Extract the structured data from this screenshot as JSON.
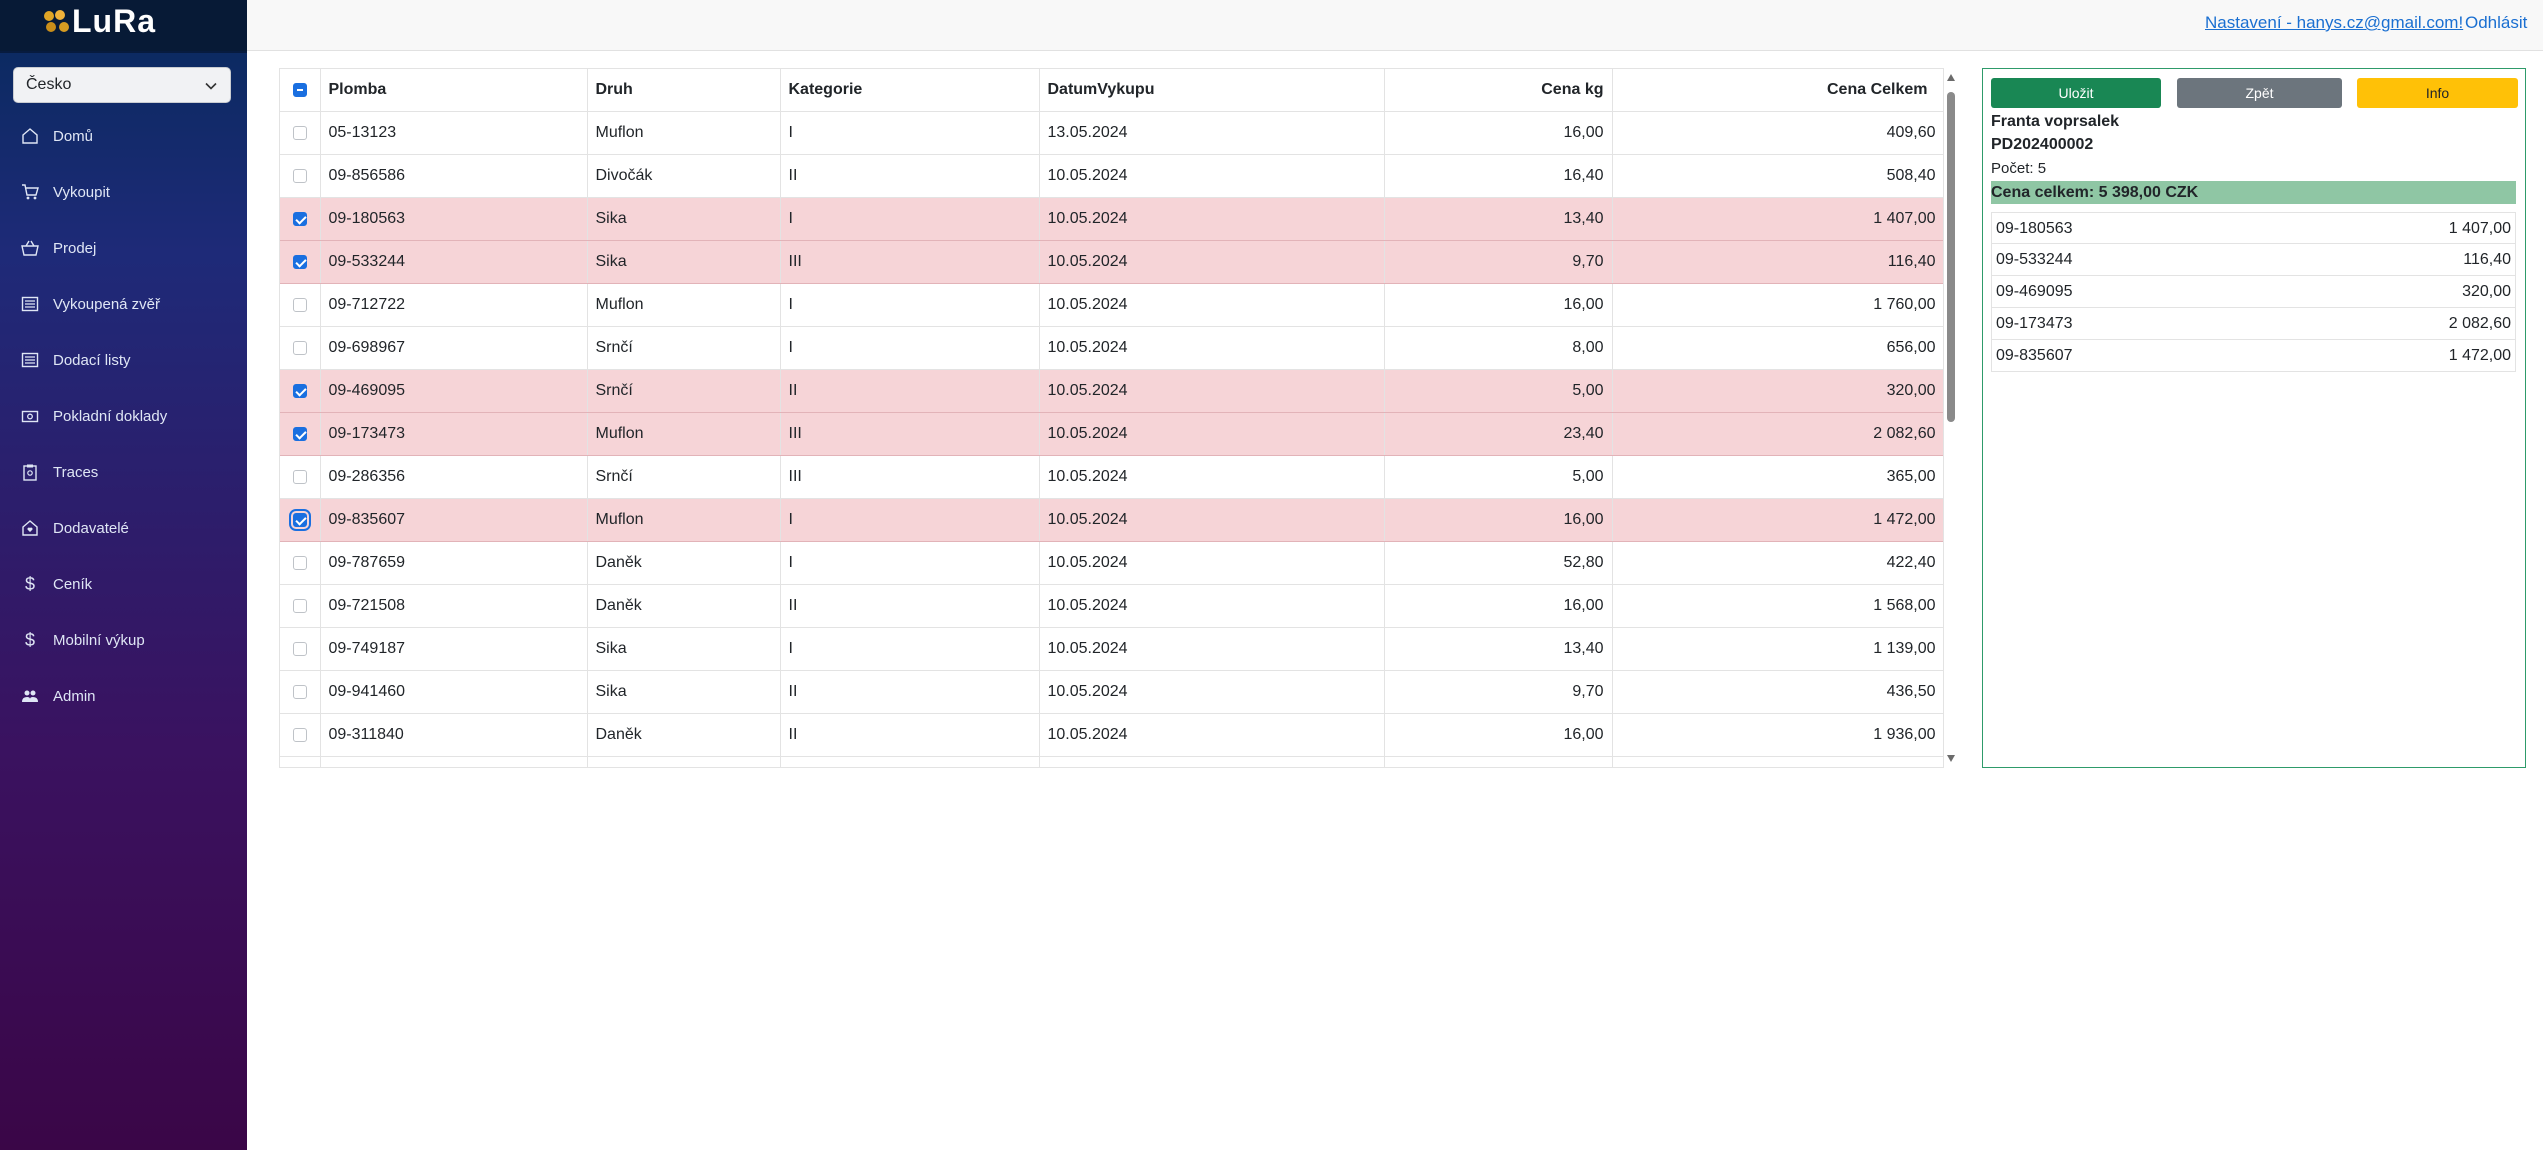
{
  "app": {
    "brand": "LuRa"
  },
  "sidebar": {
    "country": "Česko",
    "items": [
      {
        "label": "Domů",
        "icon": "home-icon"
      },
      {
        "label": "Vykoupit",
        "icon": "cart-icon"
      },
      {
        "label": "Prodej",
        "icon": "basket-icon"
      },
      {
        "label": "Vykoupená zvěř",
        "icon": "list-icon"
      },
      {
        "label": "Dodací listy",
        "icon": "list-icon"
      },
      {
        "label": "Pokladní doklady",
        "icon": "cash-icon"
      },
      {
        "label": "Traces",
        "icon": "clipboard-icon"
      },
      {
        "label": "Dodavatelé",
        "icon": "house-heart-icon"
      },
      {
        "label": "Ceník",
        "icon": "dollar-icon"
      },
      {
        "label": "Mobilní výkup",
        "icon": "dollar-icon"
      },
      {
        "label": "Admin",
        "icon": "people-icon"
      }
    ]
  },
  "topbar": {
    "settings_link": "Nastavení - hanys.cz@gmail.com!",
    "logout_link": "Odhlásit"
  },
  "table": {
    "columns": [
      "Plomba",
      "Druh",
      "Kategorie",
      "DatumVykupu",
      "Cena kg",
      "Cena Celkem"
    ],
    "rows": [
      {
        "checked": false,
        "plomba": "05-13123",
        "druh": "Muflon",
        "kategorie": "I",
        "datum": "13.05.2024",
        "cena_kg": "16,00",
        "cena_celkem": "409,60"
      },
      {
        "checked": false,
        "plomba": "09-856586",
        "druh": "Divočák",
        "kategorie": "II",
        "datum": "10.05.2024",
        "cena_kg": "16,40",
        "cena_celkem": "508,40"
      },
      {
        "checked": true,
        "plomba": "09-180563",
        "druh": "Sika",
        "kategorie": "I",
        "datum": "10.05.2024",
        "cena_kg": "13,40",
        "cena_celkem": "1 407,00"
      },
      {
        "checked": true,
        "plomba": "09-533244",
        "druh": "Sika",
        "kategorie": "III",
        "datum": "10.05.2024",
        "cena_kg": "9,70",
        "cena_celkem": "116,40"
      },
      {
        "checked": false,
        "plomba": "09-712722",
        "druh": "Muflon",
        "kategorie": "I",
        "datum": "10.05.2024",
        "cena_kg": "16,00",
        "cena_celkem": "1 760,00"
      },
      {
        "checked": false,
        "plomba": "09-698967",
        "druh": "Srnčí",
        "kategorie": "I",
        "datum": "10.05.2024",
        "cena_kg": "8,00",
        "cena_celkem": "656,00"
      },
      {
        "checked": true,
        "plomba": "09-469095",
        "druh": "Srnčí",
        "kategorie": "II",
        "datum": "10.05.2024",
        "cena_kg": "5,00",
        "cena_celkem": "320,00"
      },
      {
        "checked": true,
        "plomba": "09-173473",
        "druh": "Muflon",
        "kategorie": "III",
        "datum": "10.05.2024",
        "cena_kg": "23,40",
        "cena_celkem": "2 082,60"
      },
      {
        "checked": false,
        "plomba": "09-286356",
        "druh": "Srnčí",
        "kategorie": "III",
        "datum": "10.05.2024",
        "cena_kg": "5,00",
        "cena_celkem": "365,00"
      },
      {
        "checked": true,
        "focused": true,
        "plomba": "09-835607",
        "druh": "Muflon",
        "kategorie": "I",
        "datum": "10.05.2024",
        "cena_kg": "16,00",
        "cena_celkem": "1 472,00"
      },
      {
        "checked": false,
        "plomba": "09-787659",
        "druh": "Daněk",
        "kategorie": "I",
        "datum": "10.05.2024",
        "cena_kg": "52,80",
        "cena_celkem": "422,40"
      },
      {
        "checked": false,
        "plomba": "09-721508",
        "druh": "Daněk",
        "kategorie": "II",
        "datum": "10.05.2024",
        "cena_kg": "16,00",
        "cena_celkem": "1 568,00"
      },
      {
        "checked": false,
        "plomba": "09-749187",
        "druh": "Sika",
        "kategorie": "I",
        "datum": "10.05.2024",
        "cena_kg": "13,40",
        "cena_celkem": "1 139,00"
      },
      {
        "checked": false,
        "plomba": "09-941460",
        "druh": "Sika",
        "kategorie": "II",
        "datum": "10.05.2024",
        "cena_kg": "9,70",
        "cena_celkem": "436,50"
      },
      {
        "checked": false,
        "plomba": "09-311840",
        "druh": "Daněk",
        "kategorie": "II",
        "datum": "10.05.2024",
        "cena_kg": "16,00",
        "cena_celkem": "1 936,00"
      }
    ]
  },
  "panel": {
    "buttons": {
      "save": "Uložit",
      "back": "Zpět",
      "info": "Info"
    },
    "supplier_name": "Franta voprsalek",
    "document_code": "PD202400002",
    "count_text": "Počet: 5",
    "total_text": "Cena celkem: 5 398,00 CZK",
    "items": [
      {
        "plomba": "09-180563",
        "cena": "1 407,00"
      },
      {
        "plomba": "09-533244",
        "cena": "116,40"
      },
      {
        "plomba": "09-469095",
        "cena": "320,00"
      },
      {
        "plomba": "09-173473",
        "cena": "2 082,60"
      },
      {
        "plomba": "09-835607",
        "cena": "1 472,00"
      }
    ]
  },
  "colors": {
    "sidebar_top": "#072a5c",
    "sidebar_bottom": "#3a0647",
    "selected_row": "#f6d4d7",
    "save_button": "#198754",
    "back_button": "#6c757d",
    "info_button": "#ffc107",
    "total_highlight": "#8fc6a4",
    "link": "#1a6fd1"
  }
}
